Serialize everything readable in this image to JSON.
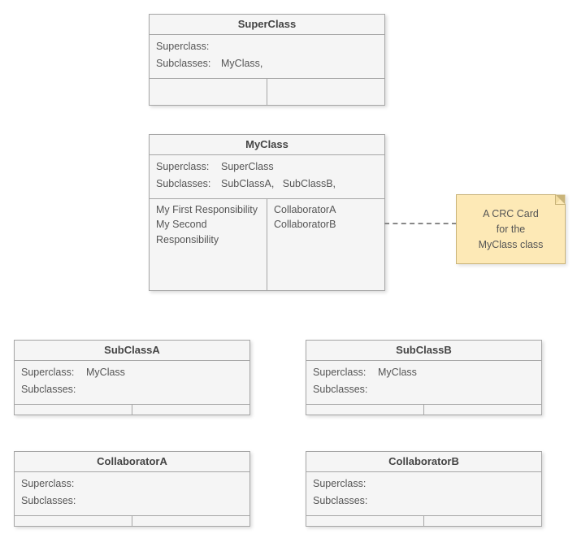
{
  "labels": {
    "superclass": "Superclass:",
    "subclasses": "Subclasses:"
  },
  "cards": {
    "superClass": {
      "name": "SuperClass",
      "superclass": "",
      "subclasses": "MyClass,",
      "responsibilities": [],
      "collaborators": []
    },
    "myClass": {
      "name": "MyClass",
      "superclass": "SuperClass",
      "subclasses": "SubClassA,   SubClassB,",
      "responsibilities": [
        "My First Responsibility",
        "My Second Responsibility"
      ],
      "collaborators": [
        "CollaboratorA",
        "CollaboratorB"
      ]
    },
    "subClassA": {
      "name": "SubClassA",
      "superclass": "MyClass",
      "subclasses": "",
      "responsibilities": [],
      "collaborators": []
    },
    "subClassB": {
      "name": "SubClassB",
      "superclass": "MyClass",
      "subclasses": "",
      "responsibilities": [],
      "collaborators": []
    },
    "collaboratorA": {
      "name": "CollaboratorA",
      "superclass": "",
      "subclasses": "",
      "responsibilities": [],
      "collaborators": []
    },
    "collaboratorB": {
      "name": "CollaboratorB",
      "superclass": "",
      "subclasses": "",
      "responsibilities": [],
      "collaborators": []
    }
  },
  "note": {
    "line1": "A CRC Card",
    "line2": "for the",
    "line3": "MyClass class"
  }
}
